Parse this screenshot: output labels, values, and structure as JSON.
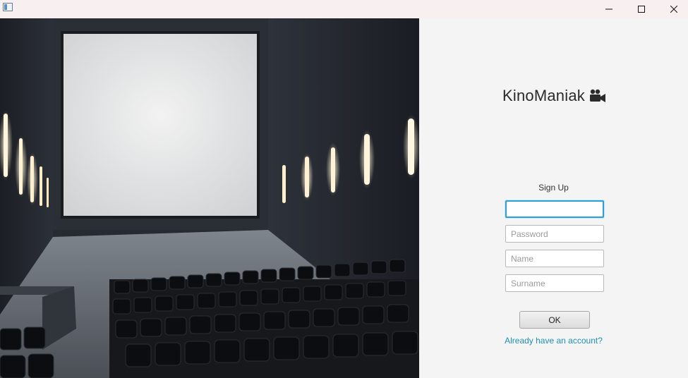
{
  "window": {
    "title": "",
    "icons": {
      "minimize": "minimize-icon",
      "maximize": "maximize-icon",
      "close": "close-icon"
    }
  },
  "brand": {
    "name": "KinoManiak",
    "icon": "video-camera-icon"
  },
  "form": {
    "title": "Sign Up",
    "fields": {
      "login": {
        "value": "",
        "placeholder": ""
      },
      "password": {
        "value": "",
        "placeholder": "Password"
      },
      "name": {
        "value": "",
        "placeholder": "Name"
      },
      "surname": {
        "value": "",
        "placeholder": "Surname"
      }
    },
    "ok_label": "OK",
    "signin_link": "Already have an account?"
  },
  "colors": {
    "accent": "#2da0d6",
    "link": "#1f8fb4",
    "panel_bg": "#f4f4f4"
  }
}
